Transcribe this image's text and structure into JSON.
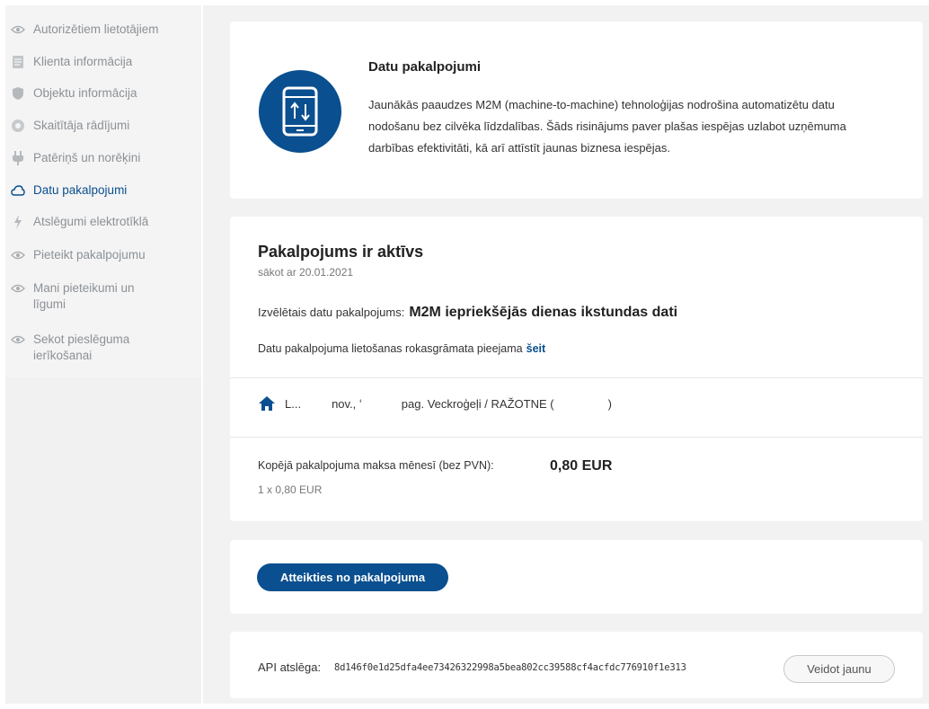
{
  "sidebar": {
    "items": [
      {
        "label": "Autorizētiem lietotājiem",
        "icon": "eye-icon"
      },
      {
        "label": "Klienta informācija",
        "icon": "document-icon"
      },
      {
        "label": "Objektu informācija",
        "icon": "shield-icon"
      },
      {
        "label": "Skaitītāja rādījumi",
        "icon": "meter-icon"
      },
      {
        "label": "Patēriņš un norēķini",
        "icon": "plug-icon"
      },
      {
        "label": "Datu pakalpojumi",
        "icon": "cloud-icon",
        "active": true
      },
      {
        "label": "Atslēgumi elektrotīklā",
        "icon": "lightning-icon"
      },
      {
        "label": "Pieteikt pakalpojumu",
        "icon": "eye-icon"
      },
      {
        "label": "Mani pieteikumi un līgumi",
        "icon": "eye-icon"
      },
      {
        "label": "Sekot pieslēguma ierīkošanai",
        "icon": "eye-icon"
      }
    ]
  },
  "hero": {
    "title": "Datu pakalpojumi",
    "text": "Jaunākās paaudzes M2M (machine-to-machine) tehnoloģijas nodrošina automatizētu datu nodošanu bez cilvēka līdzdalības. Šāds risinājums paver plašas iespējas uzlabot uzņēmuma darbības efektivitāti, kā arī attīstīt jaunas biznesa iespējas.",
    "icon": "tablet-data-transfer-icon"
  },
  "status": {
    "title": "Pakalpojums ir aktīvs",
    "date": "sākot ar 20.01.2021",
    "service_label": "Izvēlētais datu pakalpojums:",
    "service_name": "M2M iepriekšējās dienas ikstundas dati",
    "manual_text": "Datu pakalpojuma lietošanas rokasgrāmata pieejama",
    "manual_link": "šeit"
  },
  "address": {
    "part1": "L...",
    "part2": "nov., ʻ",
    "part3": "pag. Veckroģeļi / RAŽOTNE (",
    "part4": ")",
    "icon": "home-icon"
  },
  "price": {
    "label": "Kopējā pakalpojuma maksa mēnesī (bez PVN):",
    "value": "0,80 EUR",
    "detail": "1 x 0,80 EUR"
  },
  "actions": {
    "cancel_label": "Atteikties no pakalpojuma"
  },
  "api": {
    "label": "API atslēga:",
    "key": "8d146f0e1d25dfa4ee73426322998a5bea802cc39588cf4acfdc776910f1e313",
    "new_label": "Veidot jaunu"
  },
  "colors": {
    "accent": "#0a4f8f",
    "sidebar_bg": "#f4f4f4",
    "main_bg": "#f2f2f2"
  }
}
